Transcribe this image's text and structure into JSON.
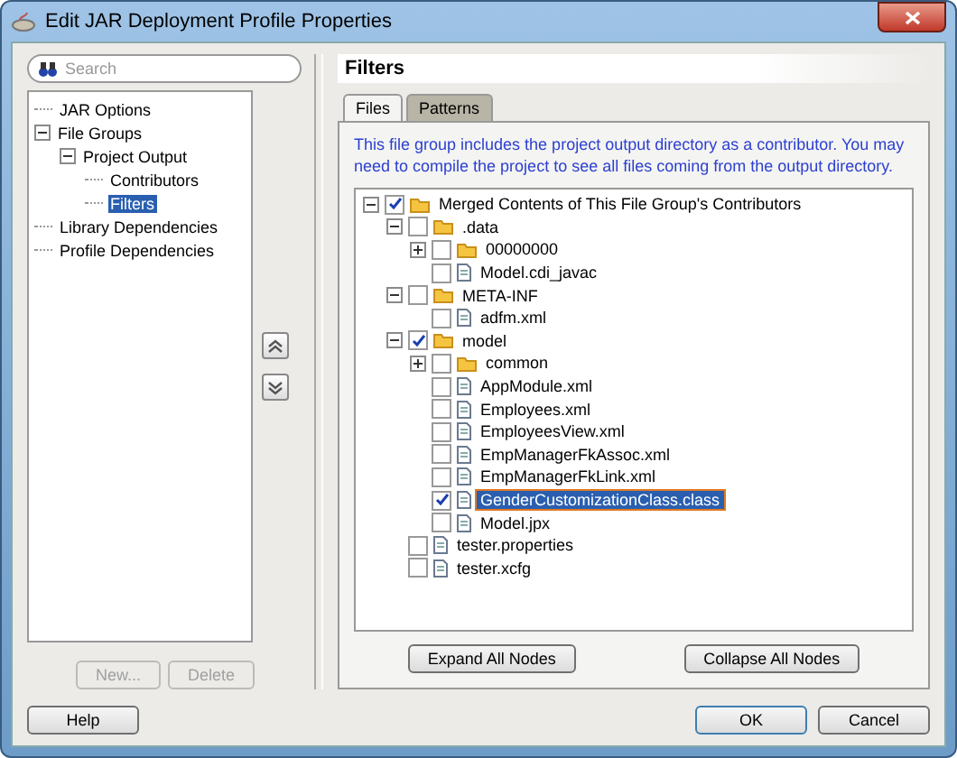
{
  "window": {
    "title": "Edit JAR Deployment Profile Properties"
  },
  "search": {
    "placeholder": "Search"
  },
  "nav_tree": [
    {
      "label": "JAR Options",
      "selected": false
    },
    {
      "label": "File Groups",
      "selected": false,
      "expanded": true,
      "children": [
        {
          "label": "Project Output",
          "selected": false,
          "expanded": true,
          "children": [
            {
              "label": "Contributors",
              "selected": false
            },
            {
              "label": "Filters",
              "selected": true
            }
          ]
        }
      ]
    },
    {
      "label": "Library Dependencies",
      "selected": false
    },
    {
      "label": "Profile Dependencies",
      "selected": false
    }
  ],
  "nav_buttons": [
    {
      "label": "New...",
      "disabled": true
    },
    {
      "label": "Delete",
      "disabled": true
    }
  ],
  "panel": {
    "title": "Filters",
    "tabs": [
      {
        "label": "Files",
        "selected": true
      },
      {
        "label": "Patterns",
        "selected": false
      }
    ],
    "description": "This file group includes the project output directory as a contributor.  You may need to compile the project to see all files coming from the output directory.",
    "file_tree": [
      {
        "label": "Merged Contents of This File Group's Contributors",
        "kind": "folder",
        "checked": true,
        "selected": false,
        "expanded": true,
        "children": [
          {
            "label": ".data",
            "kind": "folder",
            "checked": false,
            "selected": false,
            "expanded": true,
            "children": [
              {
                "label": "00000000",
                "kind": "folder",
                "checked": false,
                "selected": false,
                "expanded": false
              },
              {
                "label": "Model.cdi_javac",
                "kind": "file",
                "checked": false,
                "selected": false
              }
            ]
          },
          {
            "label": "META-INF",
            "kind": "folder",
            "checked": false,
            "selected": false,
            "expanded": true,
            "children": [
              {
                "label": "adfm.xml",
                "kind": "file",
                "checked": false,
                "selected": false
              }
            ]
          },
          {
            "label": "model",
            "kind": "folder",
            "checked": true,
            "selected": false,
            "expanded": true,
            "children": [
              {
                "label": "common",
                "kind": "folder",
                "checked": false,
                "selected": false,
                "expanded": false
              },
              {
                "label": "AppModule.xml",
                "kind": "file",
                "checked": false,
                "selected": false
              },
              {
                "label": "Employees.xml",
                "kind": "file",
                "checked": false,
                "selected": false
              },
              {
                "label": "EmployeesView.xml",
                "kind": "file",
                "checked": false,
                "selected": false
              },
              {
                "label": "EmpManagerFkAssoc.xml",
                "kind": "file",
                "checked": false,
                "selected": false
              },
              {
                "label": "EmpManagerFkLink.xml",
                "kind": "file",
                "checked": false,
                "selected": false
              },
              {
                "label": "GenderCustomizationClass.class",
                "kind": "file",
                "checked": true,
                "selected": true
              },
              {
                "label": "Model.jpx",
                "kind": "file",
                "checked": false,
                "selected": false
              }
            ]
          },
          {
            "label": "tester.properties",
            "kind": "file",
            "checked": false,
            "selected": false
          },
          {
            "label": "tester.xcfg",
            "kind": "file",
            "checked": false,
            "selected": false
          }
        ]
      }
    ],
    "tree_buttons": [
      {
        "label": "Expand All Nodes"
      },
      {
        "label": "Collapse All Nodes"
      }
    ]
  },
  "footer": {
    "help": "Help",
    "ok": "OK",
    "cancel": "Cancel"
  }
}
